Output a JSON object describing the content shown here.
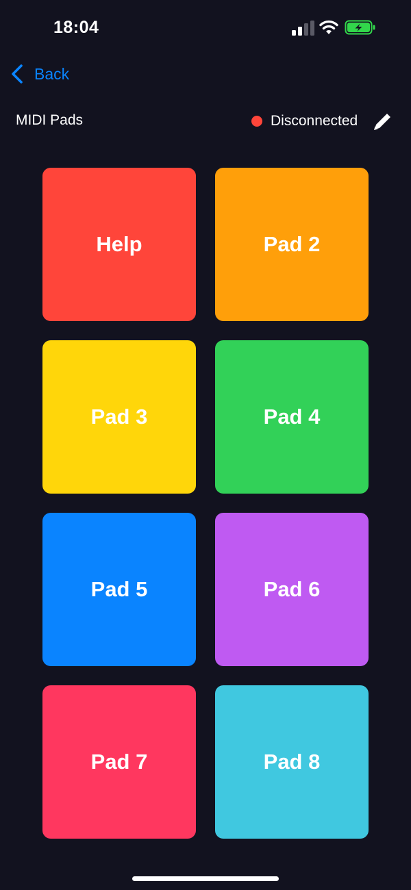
{
  "status_bar": {
    "time": "18:04",
    "signal_icon": "cellular-signal-icon",
    "wifi_icon": "wifi-icon",
    "battery_icon": "battery-charging-icon",
    "battery_color": "#32d74b"
  },
  "nav": {
    "back_label": "Back",
    "back_icon": "chevron-left-icon",
    "accent_color": "#0a84ff"
  },
  "header": {
    "title": "MIDI Pads",
    "status_label": "Disconnected",
    "status_color": "#ff453a",
    "edit_icon": "pencil-icon"
  },
  "pads": [
    {
      "label": "Help",
      "color": "#ff453a"
    },
    {
      "label": "Pad 2",
      "color": "#ff9f0a"
    },
    {
      "label": "Pad 3",
      "color": "#ffd60a"
    },
    {
      "label": "Pad 4",
      "color": "#32d158"
    },
    {
      "label": "Pad 5",
      "color": "#0a84ff"
    },
    {
      "label": "Pad 6",
      "color": "#bf5af2"
    },
    {
      "label": "Pad 7",
      "color": "#ff375f"
    },
    {
      "label": "Pad 8",
      "color": "#40c8e0"
    }
  ]
}
